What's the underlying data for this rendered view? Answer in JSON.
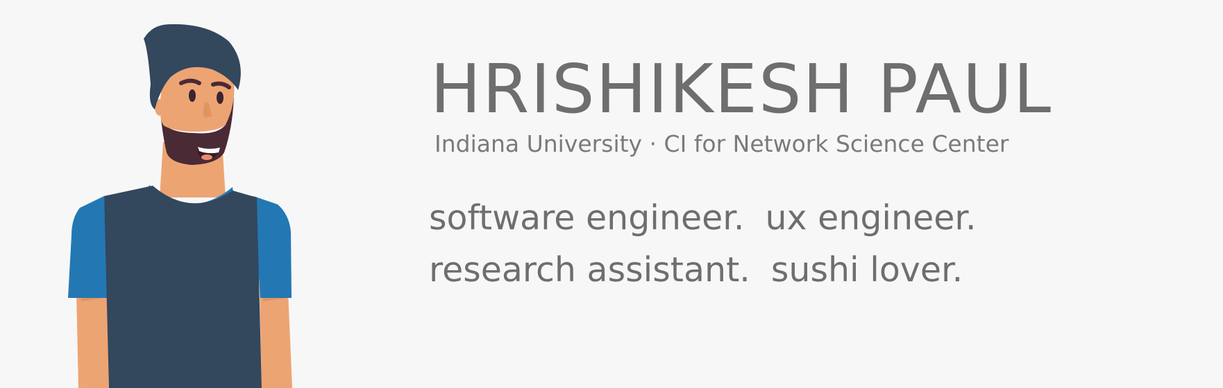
{
  "header": {
    "name": "HRISHIKESH PAUL",
    "affiliation": "Indiana University · CI for Network Science Center"
  },
  "roles": {
    "line1": [
      "software engineer.",
      "ux engineer."
    ],
    "line2": [
      "research assistant.",
      "sushi lover."
    ]
  },
  "avatar": {
    "icon": "person-with-turban-illustration",
    "colors": {
      "turban": "#33475d",
      "skin": "#eda473",
      "beard": "#4a2a35",
      "shirt": "#33475d",
      "sleeves": "#2378b4",
      "background": "#f7f7f7",
      "text": "#6e6e6e"
    }
  }
}
